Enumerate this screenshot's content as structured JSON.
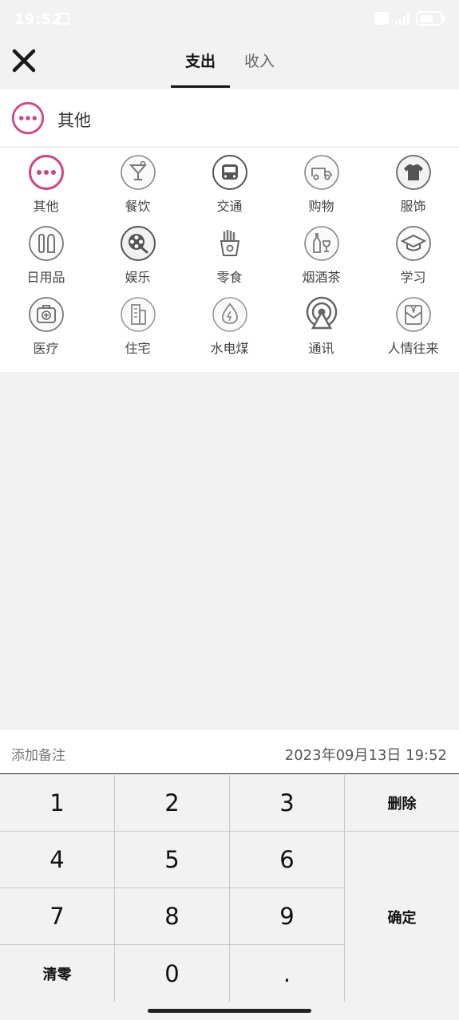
{
  "status_bar": {
    "time": "19:52"
  },
  "header": {
    "tabs": [
      {
        "label": "支出",
        "active": true
      },
      {
        "label": "收入",
        "active": false
      }
    ]
  },
  "selected_category": {
    "label": "其他",
    "icon": "more-dots-icon"
  },
  "categories": [
    {
      "label": "其他",
      "icon": "more-dots-icon"
    },
    {
      "label": "餐饮",
      "icon": "cocktail-icon"
    },
    {
      "label": "交通",
      "icon": "bus-icon"
    },
    {
      "label": "购物",
      "icon": "delivery-truck-icon"
    },
    {
      "label": "服饰",
      "icon": "tshirt-icon"
    },
    {
      "label": "日用品",
      "icon": "toiletries-icon"
    },
    {
      "label": "娱乐",
      "icon": "film-reel-icon"
    },
    {
      "label": "零食",
      "icon": "fries-icon"
    },
    {
      "label": "烟酒茶",
      "icon": "wine-icon"
    },
    {
      "label": "学习",
      "icon": "graduation-cap-icon"
    },
    {
      "label": "医疗",
      "icon": "medical-kit-icon"
    },
    {
      "label": "住宅",
      "icon": "building-icon"
    },
    {
      "label": "水电煤",
      "icon": "water-drop-bolt-icon"
    },
    {
      "label": "通讯",
      "icon": "signal-tower-icon"
    },
    {
      "label": "人情往来",
      "icon": "red-envelope-icon"
    }
  ],
  "notes": {
    "placeholder": "添加备注"
  },
  "datetime": "2023年09月13日 19:52",
  "keypad": {
    "k1": "1",
    "k2": "2",
    "k3": "3",
    "delete": "删除",
    "k4": "4",
    "k5": "5",
    "k6": "6",
    "confirm": "确定",
    "k7": "7",
    "k8": "8",
    "k9": "9",
    "clear": "清零",
    "k0": "0",
    "dot": "."
  },
  "colors": {
    "accent": "#d63f86",
    "icon_gray": "#555555",
    "background": "#f2f2f2"
  }
}
